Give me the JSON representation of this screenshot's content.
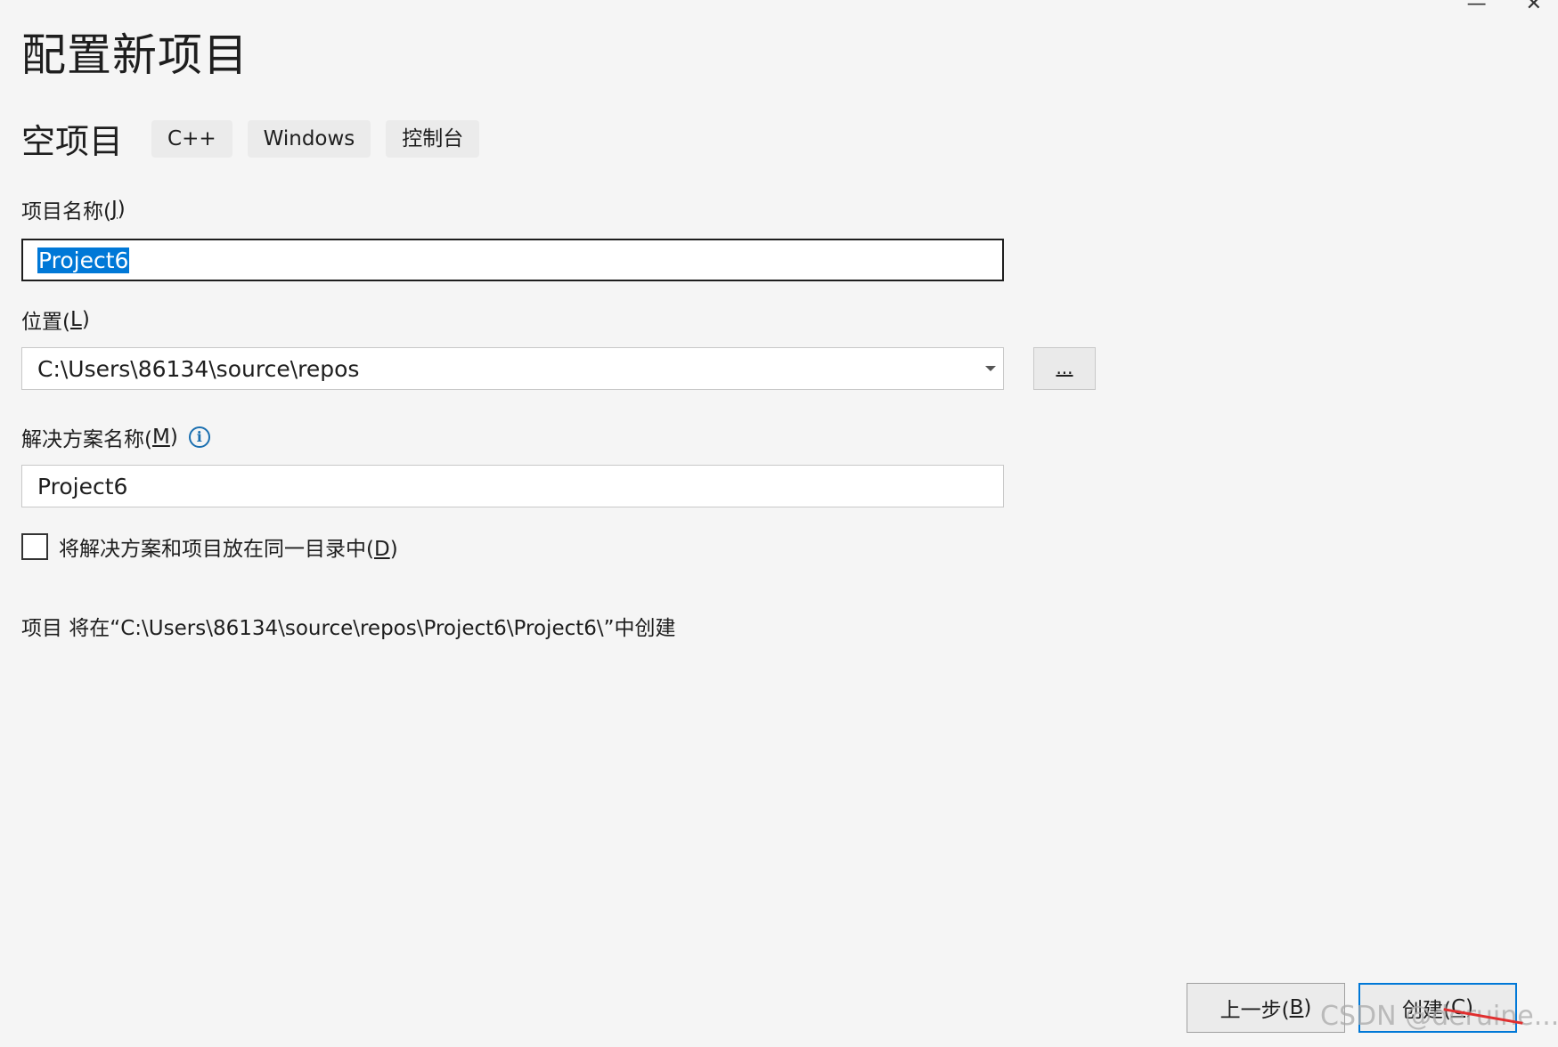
{
  "window": {
    "minimize_glyph": "—",
    "close_glyph": "✕"
  },
  "page_title": "配置新项目",
  "template": {
    "name": "空项目",
    "tags": [
      "C++",
      "Windows",
      "控制台"
    ]
  },
  "project_name": {
    "label": "项目名称(",
    "label_key": "J",
    "label_end": ")",
    "value": "Project6"
  },
  "location": {
    "label": "位置(",
    "label_key": "L",
    "label_end": ")",
    "value": "C:\\Users\\86134\\source\\repos",
    "browse_label": "..."
  },
  "solution_name": {
    "label": "解决方案名称(",
    "label_key": "M",
    "label_end": ")",
    "info_glyph": "i",
    "value": "Project6"
  },
  "same_dir_checkbox": {
    "label": "将解决方案和项目放在同一目录中(",
    "label_key": "D",
    "label_end": ")",
    "checked": false
  },
  "path_note": "项目 将在“C:\\Users\\86134\\source\\repos\\Project6\\Project6\\”中创建",
  "footer": {
    "back_label": "上一步(",
    "back_key": "B",
    "back_end": ")",
    "create_label": "创建(",
    "create_key": "C",
    "create_end": ")"
  },
  "watermark": "CSDN @deruine..."
}
